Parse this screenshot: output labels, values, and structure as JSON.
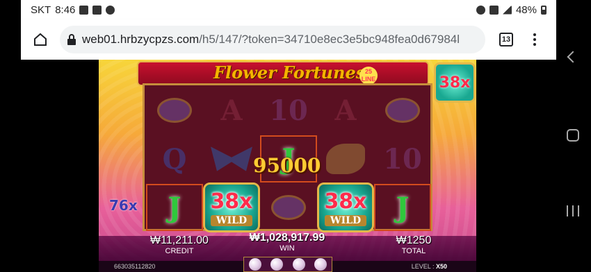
{
  "status_bar": {
    "carrier": "SKT",
    "time": "8:46",
    "battery": "48%"
  },
  "browser": {
    "url_host": "web01.hrbzycpzs.com",
    "url_path": "/h5/147/?token=34710e8ec3e5bc948fea0d67984l",
    "tab_count": "13"
  },
  "game": {
    "logo": "Flower Fortunes",
    "lines_badge": "25 LINE",
    "corner_multiplier": "38x",
    "side_multiplier": "76x",
    "win_amount": "95000",
    "reels": {
      "row1": [
        "",
        "A",
        "10",
        "A",
        ""
      ],
      "row2": [
        "Q",
        "",
        "J",
        "",
        "10"
      ],
      "row3": [
        "J",
        "38x",
        "",
        "38x",
        "J"
      ]
    },
    "wild_label": "WILD",
    "credit_value": "₩11,211.00",
    "credit_label": "CREDIT",
    "win_value": "₩1,028,917.99",
    "win_label": "WIN",
    "total_value": "₩1250",
    "total_label": "TOTAL",
    "game_id": "663035112820",
    "level_label": "LEVEL :",
    "level_value": "X50"
  }
}
